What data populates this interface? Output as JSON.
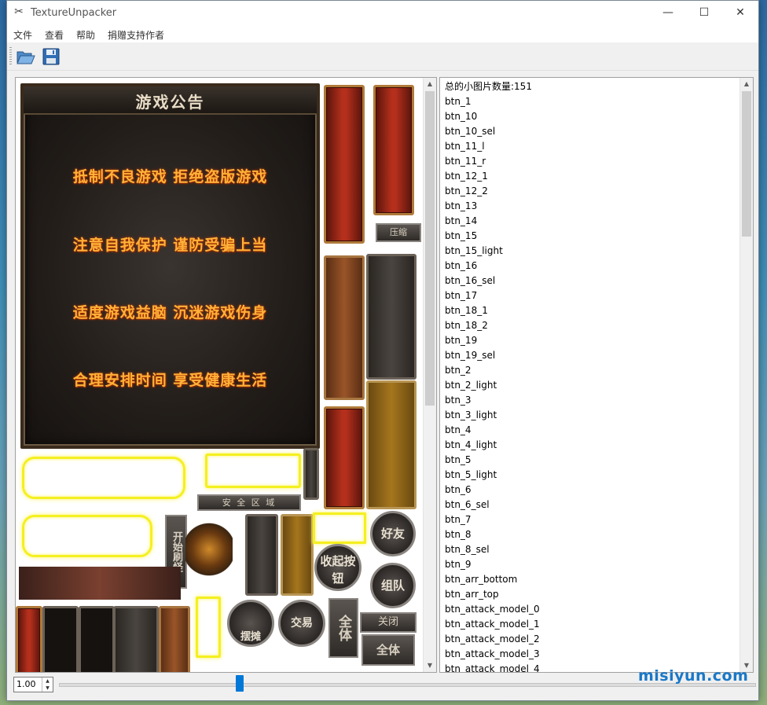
{
  "window": {
    "title": "TextureUnpacker",
    "minimize": "—",
    "maximize": "☐",
    "close": "✕"
  },
  "menu": {
    "items": [
      "文件",
      "查看",
      "帮助",
      "捐赠支持作者"
    ]
  },
  "toolbar": {
    "open_icon": "folder-open-icon",
    "save_icon": "floppy-save-icon"
  },
  "preview": {
    "notice_title": "游戏公告",
    "notice_lines": [
      "抵制不良游戏  拒绝盗版游戏",
      "注意自我保护  谨防受骗上当",
      "适度游戏益脑  沉迷游戏伤身",
      "合理安排时间  享受健康生活"
    ],
    "sprite_labels": {
      "lock_tag": "压缩",
      "safe_zone": "安 全 区 域",
      "start_monster": "开始刷怪",
      "collapse": "收起按钮",
      "friends": "好友",
      "group": "组队",
      "stall": "摆摊",
      "all": "全体",
      "close": "关闭",
      "all_2": "全体",
      "trade": "交易"
    }
  },
  "list": {
    "header": "总的小图片数量:151",
    "items": [
      "btn_1",
      "btn_10",
      "btn_10_sel",
      "btn_11_l",
      "btn_11_r",
      "btn_12_1",
      "btn_12_2",
      "btn_13",
      "btn_14",
      "btn_15",
      "btn_15_light",
      "btn_16",
      "btn_16_sel",
      "btn_17",
      "btn_18_1",
      "btn_18_2",
      "btn_19",
      "btn_19_sel",
      "btn_2",
      "btn_2_light",
      "btn_3",
      "btn_3_light",
      "btn_4",
      "btn_4_light",
      "btn_5",
      "btn_5_light",
      "btn_6",
      "btn_6_sel",
      "btn_7",
      "btn_8",
      "btn_8_sel",
      "btn_9",
      "btn_arr_bottom",
      "btn_arr_top",
      "btn_attack_model_0",
      "btn_attack_model_1",
      "btn_attack_model_2",
      "btn_attack_model_3",
      "btn_attack_model_4"
    ]
  },
  "zoom": {
    "value": "1.00",
    "slider_level": 0.26
  },
  "watermark": "misiyun.com",
  "colors": {
    "accent": "#0078d7",
    "notice_text": "#ffb238"
  }
}
